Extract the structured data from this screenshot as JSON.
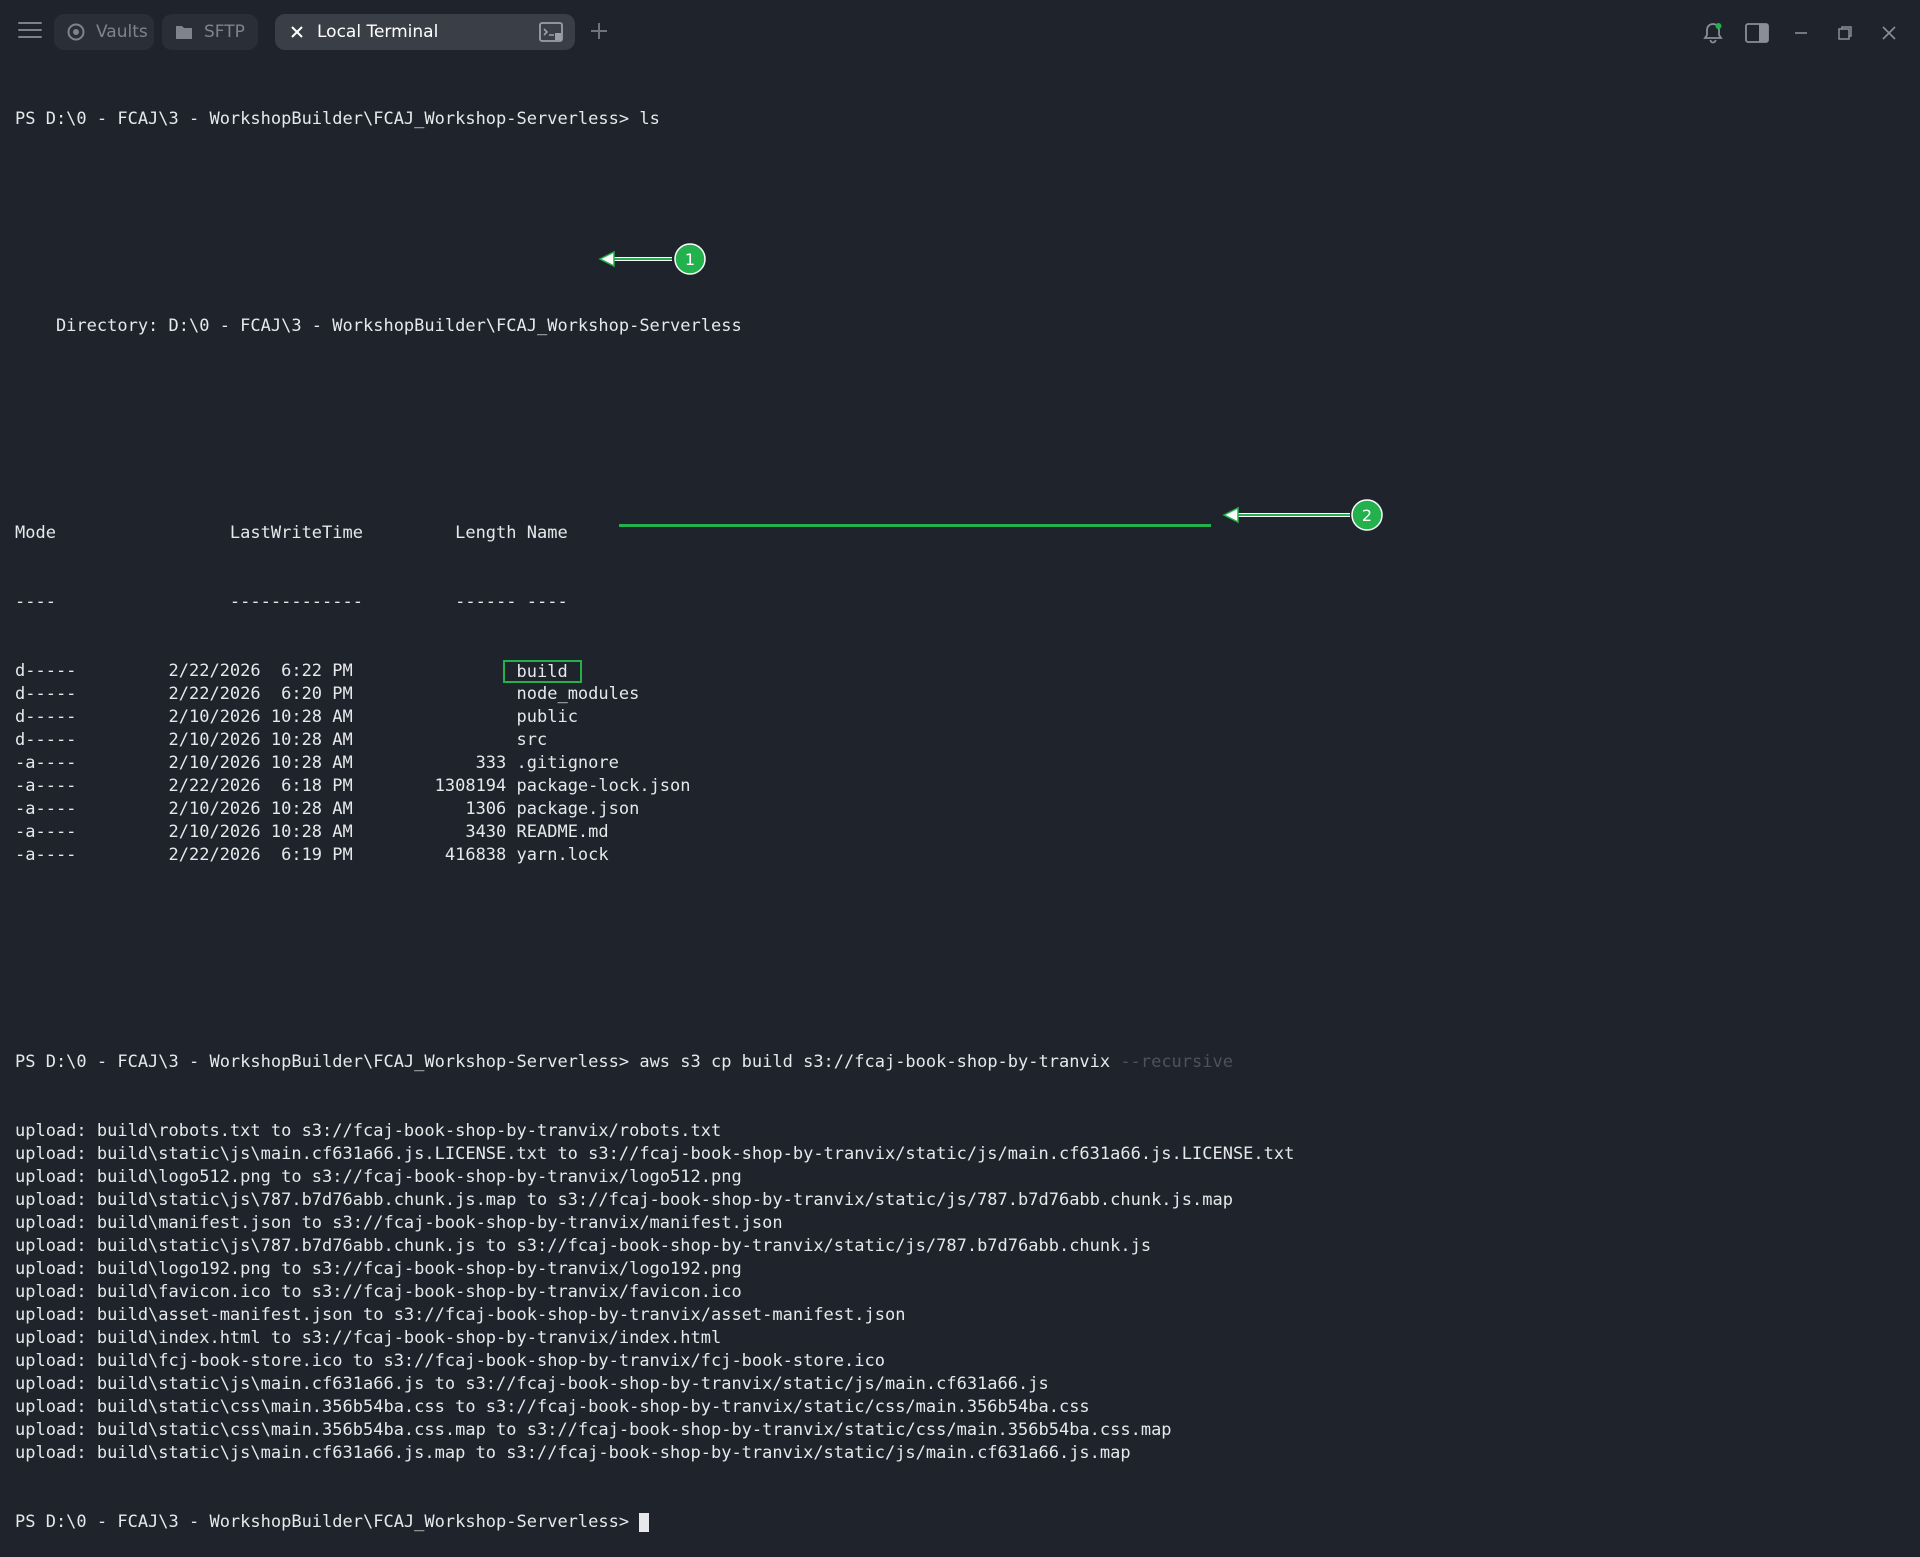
{
  "tabs": [
    {
      "label": "Vaults",
      "icon": "vault-icon"
    },
    {
      "label": "SFTP",
      "icon": "folder-icon"
    },
    {
      "label": "Local Terminal",
      "icon": "close-icon",
      "action_icon": "terminal-split-icon"
    }
  ],
  "toolbar": {
    "menu_icon": "hamburger-menu-icon",
    "add_tab_icon": "plus-icon",
    "notifications_icon": "bell-icon",
    "sidebar_toggle_icon": "sidebar-toggle-icon",
    "minimize_icon": "minimize-icon",
    "maximize_icon": "restore-icon",
    "close_icon": "close-icon"
  },
  "terminal": {
    "prompt": "PS D:\\0 - FCAJ\\3 - WorkshopBuilder\\FCAJ_Workshop-Serverless> ",
    "cmd1": "ls",
    "directory_line": "    Directory: D:\\0 - FCAJ\\3 - WorkshopBuilder\\FCAJ_Workshop-Serverless",
    "header_line": "Mode                 LastWriteTime         Length Name",
    "separator_line": "----                 -------------         ------ ----",
    "rows": [
      {
        "mode": "d-----",
        "date": "2/22/2026",
        "time": " 6:22 PM",
        "length": "",
        "name": "build"
      },
      {
        "mode": "d-----",
        "date": "2/22/2026",
        "time": " 6:20 PM",
        "length": "",
        "name": "node_modules"
      },
      {
        "mode": "d-----",
        "date": "2/10/2026",
        "time": "10:28 AM",
        "length": "",
        "name": "public"
      },
      {
        "mode": "d-----",
        "date": "2/10/2026",
        "time": "10:28 AM",
        "length": "",
        "name": "src"
      },
      {
        "mode": "-a----",
        "date": "2/10/2026",
        "time": "10:28 AM",
        "length": "333",
        "name": ".gitignore"
      },
      {
        "mode": "-a----",
        "date": "2/22/2026",
        "time": " 6:18 PM",
        "length": "1308194",
        "name": "package-lock.json"
      },
      {
        "mode": "-a----",
        "date": "2/10/2026",
        "time": "10:28 AM",
        "length": "1306",
        "name": "package.json"
      },
      {
        "mode": "-a----",
        "date": "2/10/2026",
        "time": "10:28 AM",
        "length": "3430",
        "name": "README.md"
      },
      {
        "mode": "-a----",
        "date": "2/22/2026",
        "time": " 6:19 PM",
        "length": "416838",
        "name": "yarn.lock"
      }
    ],
    "cmd2": "aws s3 cp build s3://fcaj-book-shop-by-tranvix",
    "cmd2_suggestion": " --recursive",
    "uploads": [
      "upload: build\\robots.txt to s3://fcaj-book-shop-by-tranvix/robots.txt",
      "upload: build\\static\\js\\main.cf631a66.js.LICENSE.txt to s3://fcaj-book-shop-by-tranvix/static/js/main.cf631a66.js.LICENSE.txt",
      "upload: build\\logo512.png to s3://fcaj-book-shop-by-tranvix/logo512.png",
      "upload: build\\static\\js\\787.b7d76abb.chunk.js.map to s3://fcaj-book-shop-by-tranvix/static/js/787.b7d76abb.chunk.js.map",
      "upload: build\\manifest.json to s3://fcaj-book-shop-by-tranvix/manifest.json",
      "upload: build\\static\\js\\787.b7d76abb.chunk.js to s3://fcaj-book-shop-by-tranvix/static/js/787.b7d76abb.chunk.js",
      "upload: build\\logo192.png to s3://fcaj-book-shop-by-tranvix/logo192.png",
      "upload: build\\favicon.ico to s3://fcaj-book-shop-by-tranvix/favicon.ico",
      "upload: build\\asset-manifest.json to s3://fcaj-book-shop-by-tranvix/asset-manifest.json",
      "upload: build\\index.html to s3://fcaj-book-shop-by-tranvix/index.html",
      "upload: build\\fcj-book-store.ico to s3://fcaj-book-shop-by-tranvix/fcj-book-store.ico",
      "upload: build\\static\\js\\main.cf631a66.js to s3://fcaj-book-shop-by-tranvix/static/js/main.cf631a66.js",
      "upload: build\\static\\css\\main.356b54ba.css to s3://fcaj-book-shop-by-tranvix/static/css/main.356b54ba.css",
      "upload: build\\static\\css\\main.356b54ba.css.map to s3://fcaj-book-shop-by-tranvix/static/css/main.356b54ba.css.map",
      "upload: build\\static\\js\\main.cf631a66.js.map to s3://fcaj-book-shop-by-tranvix/static/js/main.cf631a66.js.map"
    ]
  },
  "annotations": {
    "marker1": "1",
    "marker2": "2",
    "color": "#22b14c"
  }
}
